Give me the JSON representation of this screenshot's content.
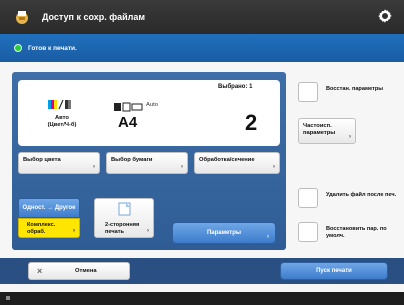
{
  "header": {
    "title": "Доступ к сохр. файлам"
  },
  "status": {
    "text": "Готов к печати."
  },
  "settings": {
    "copies_label": "Выбрано: 1",
    "color_label_line1": "Авто",
    "color_label_line2": "(Цвет/Ч-б)",
    "paper_auto": "Auto",
    "paper_size": "A4",
    "copy_count": "2"
  },
  "buttons": {
    "color_select": "Выбор цвета",
    "paper_select": "Выбор бумаги",
    "finishing": "Обработка/сечение",
    "one_sided_label": "Одност. → Другое",
    "finishing_mode_line1": "Комплекс.",
    "finishing_mode_line2": "обраб.",
    "two_sided_line1": "2-сторонняя",
    "two_sided_line2": "печать",
    "options": "Параметры",
    "reset": "Восстан. параметры",
    "frequent": "Частоисп. параметры",
    "delete_after_print": "Удалить файл после печ.",
    "restore_defaults": "Восстановить пар. по умолч.",
    "cancel": "Отмена",
    "start_print": "Пуск печати"
  },
  "colors": {
    "title_bar": "#2f2f2f",
    "status_bar": "#1f6fbd",
    "accent_blue": "#3d7ccc",
    "yellow": "#ffe600"
  }
}
